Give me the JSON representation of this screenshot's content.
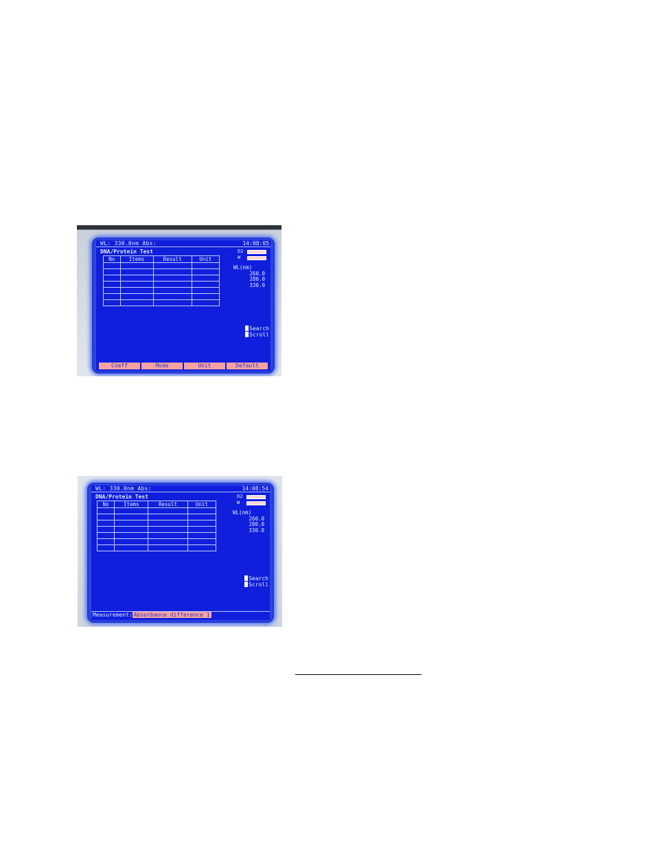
{
  "screens": [
    {
      "wl_readout": "WL: 330.0nm Abs:",
      "clock": "14:08:05",
      "title": "DNA/Protein Test",
      "lamps": [
        "D2",
        "W"
      ],
      "columns": [
        "No",
        "Items",
        "Result",
        "Unit"
      ],
      "wl_header": "WL(nm)",
      "wavelengths": [
        "260.0",
        "280.0",
        "330.0"
      ],
      "hints": [
        "Search",
        "Scroll"
      ],
      "softkeys": [
        "Coeff",
        "Mode",
        "Unit",
        "Default"
      ]
    },
    {
      "wl_readout": "WL: 330.0nm Abs:",
      "clock": "14:08:54",
      "title": "DNA/Protein Test",
      "lamps": [
        "D2",
        "W"
      ],
      "columns": [
        "No",
        "Items",
        "Result",
        "Unit"
      ],
      "wl_header": "WL(nm)",
      "wavelengths": [
        "260.0",
        "280.0",
        "330.0"
      ],
      "hints": [
        "Search",
        "Scroll"
      ],
      "status_label": "Measurement:",
      "status_value": "Absorbance difference 1"
    }
  ]
}
